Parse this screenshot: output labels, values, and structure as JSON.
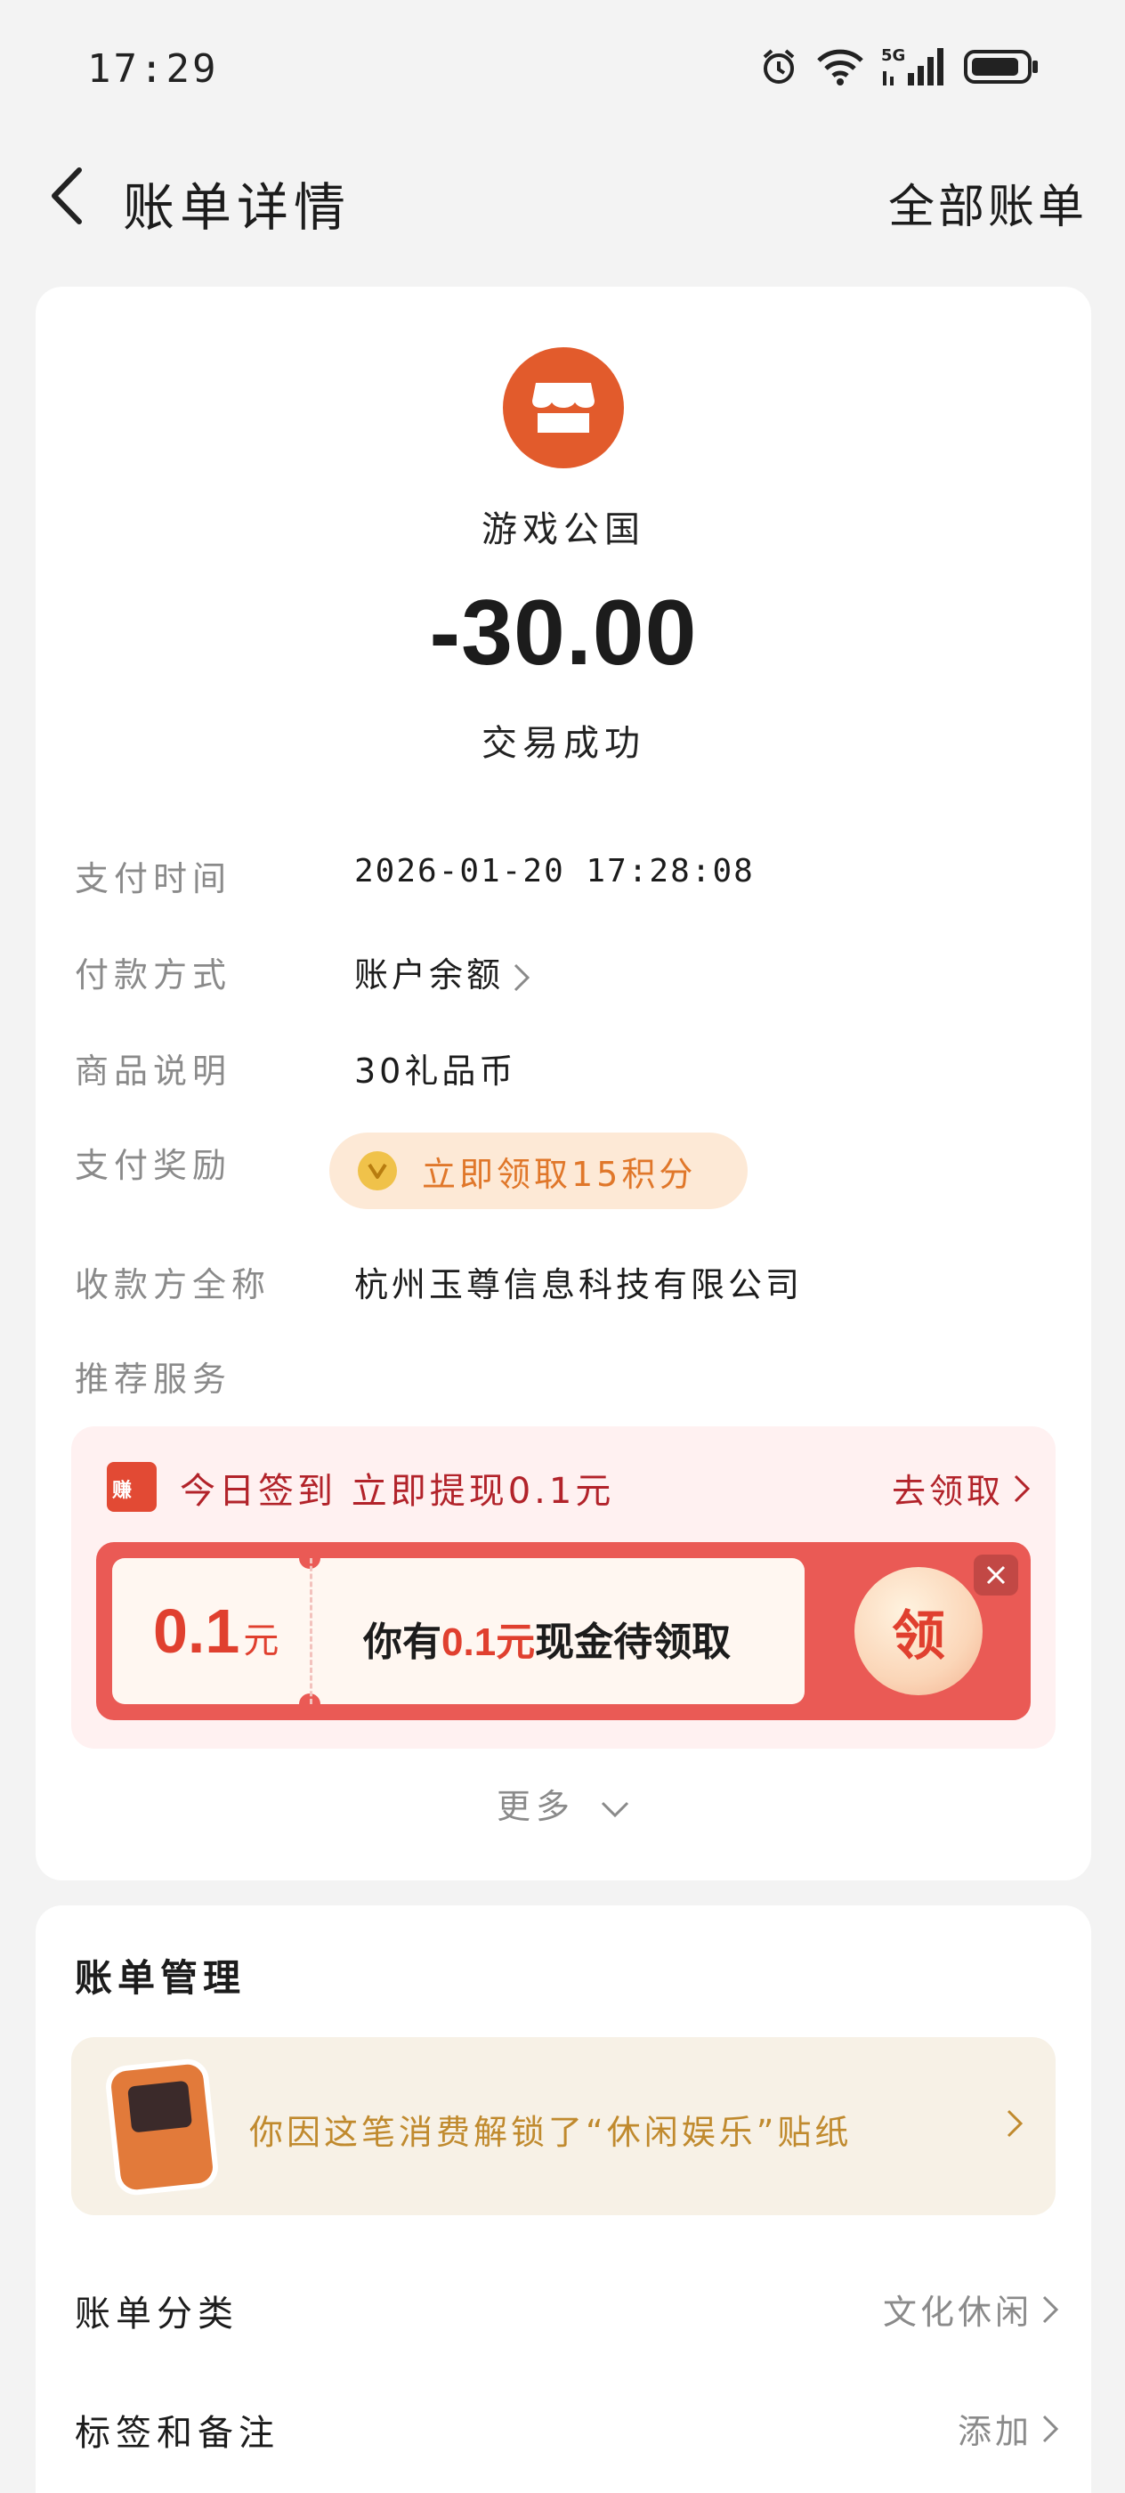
{
  "status_bar": {
    "time": "17:29",
    "icons": [
      "alarm-icon",
      "wifi-icon",
      "5g-signal-icon",
      "battery-icon"
    ]
  },
  "nav": {
    "title": "账单详情",
    "right_link": "全部账单"
  },
  "transaction": {
    "merchant": "游戏公国",
    "amount": "-30.00",
    "status": "交易成功",
    "logo_color": "#e25b2c"
  },
  "details": {
    "pay_time_label": "支付时间",
    "pay_time": "2026-01-20 17:28:08",
    "method_label": "付款方式",
    "method": "账户余额",
    "item_label": "商品说明",
    "item": "30礼品币",
    "reward_label": "支付奖励",
    "reward": "立即领取15积分",
    "payee_label": "收款方全称",
    "payee": "杭州玉尊信息科技有限公司",
    "recommend_label": "推荐服务"
  },
  "promo": {
    "cal_text": "赚",
    "title": "今日签到  立即提现0.1元",
    "link": "去领取",
    "coupon_amount": "0.1",
    "coupon_unit": "元",
    "coupon_desc_prefix": "你有",
    "coupon_desc_highlight": "0.1元",
    "coupon_desc_suffix": "现金待领取",
    "claim_button": "领"
  },
  "more": "更多",
  "manage": {
    "title": "账单管理",
    "sticker_text": "你因这笔消费解锁了“休闲娱乐”贴纸",
    "category_label": "账单分类",
    "category_value": "文化休闲",
    "tags_label": "标签和备注",
    "tags_value": "添加"
  },
  "colors": {
    "accent_red": "#e0402f",
    "promo_text": "#b2232a",
    "reward_orange": "#e0772a",
    "sticker_gold": "#c08a2e"
  }
}
